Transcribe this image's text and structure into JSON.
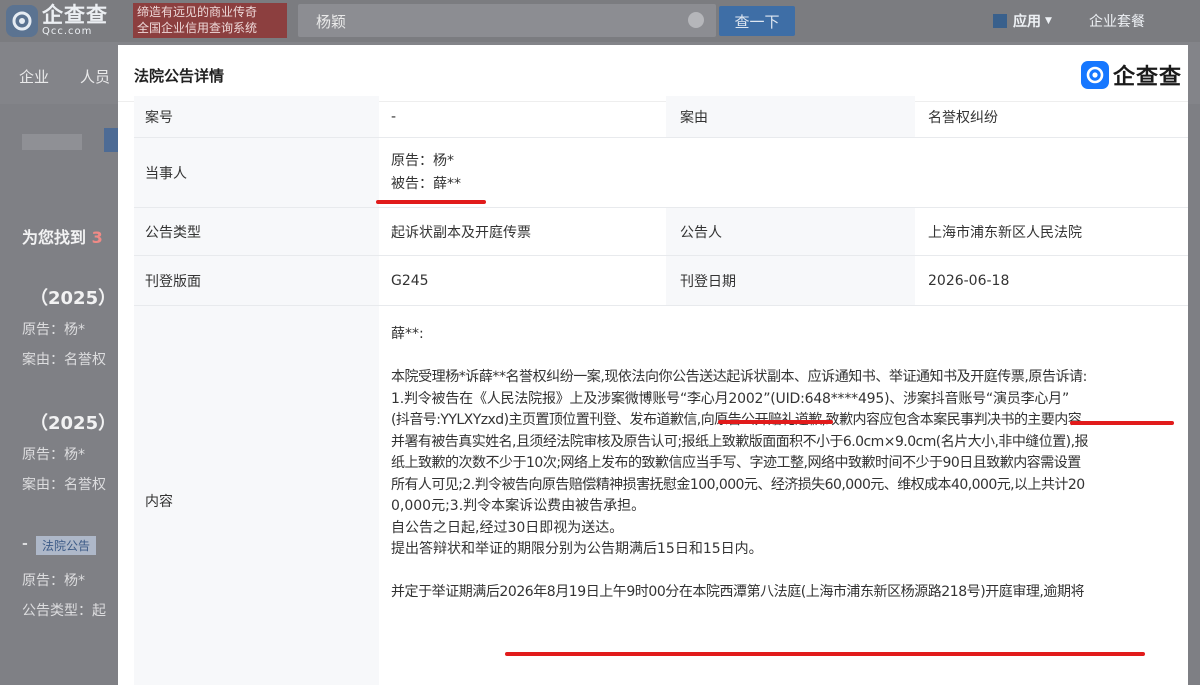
{
  "header": {
    "logo_cn": "企查查",
    "logo_en": "Qcc.com",
    "slogan_line1": "缔造有远见的商业传奇",
    "slogan_line2": "全国企业信用查询系统",
    "search_value": "杨颖",
    "search_button": "查一下",
    "app_menu": "应用",
    "corp_package": "企业套餐"
  },
  "subnav": {
    "items": [
      "企业",
      "人员"
    ]
  },
  "background_list": {
    "found_prefix": "为您找到",
    "found_count": "3",
    "cases": [
      {
        "title": "（2025）",
        "plaintiff": "原告：杨*",
        "cause": "案由：名誉权"
      },
      {
        "title": "（2025）",
        "plaintiff": "原告：杨*",
        "cause": "案由：名誉权"
      }
    ],
    "third_item": {
      "dash": "-",
      "tag": "法院公告",
      "plaintiff": "原告：杨*",
      "type": "公告类型：起"
    }
  },
  "modal": {
    "title": "法院公告详情",
    "brand_text": "企查查",
    "rows": {
      "case_no_label": "案号",
      "case_no_value": "-",
      "cause_label": "案由",
      "cause_value": "名誉权纠纷",
      "party_label": "当事人",
      "plaintiff": "原告：杨*",
      "defendant": "被告：薛**",
      "notice_type_label": "公告类型",
      "notice_type_value": "起诉状副本及开庭传票",
      "announcer_label": "公告人",
      "announcer_value": "上海市浦东新区人民法院",
      "page_label": "刊登版面",
      "page_value": "G245",
      "date_label": "刊登日期",
      "date_value": "2026-06-18",
      "content_label": "内容"
    },
    "content_lines": [
      "薛**:",
      "",
      "本院受理杨*诉薛**名誉权纠纷一案,现依法向你公告送达起诉状副本、应诉通知书、举证通知书及开庭传票,原告诉请:",
      "1.判令被告在《人民法院报》上及涉案微博账号“李心月2002”(UID:648****495)、涉案抖音账号“演员李心月”",
      "(抖音号:YYLXYzxd)主页置顶位置刊登、发布道歉信,向原告公开赔礼道歉,致歉内容应包含本案民事判决书的主要内容",
      "并署有被告真实姓名,且须经法院审核及原告认可;报纸上致歉版面面积不小于6.0cm×9.0cm(名片大小,非中缝位置),报",
      "纸上致歉的次数不少于10次;网络上发布的致歉信应当手写、字迹工整,网络中致歉时间不少于90日且致歉内容需设置",
      "所有人可见;2.判令被告向原告赔偿精神损害抚慰金100,000元、经济损失60,000元、维权成本40,000元,以上共计20",
      "0,000元;3.判令本案诉讼费由被告承担。",
      "自公告之日起,经过30日即视为送达。",
      "提出答辩状和举证的期限分别为公告期满后15日和15日内。",
      "",
      "并定于举证期满后2026年8月19日上午9时00分在本院西潭第八法庭(上海市浦东新区杨源路218号)开庭审理,逾期将"
    ]
  },
  "colors": {
    "highlight_underline": "#e11b1b",
    "brand_blue": "#1677ff"
  }
}
